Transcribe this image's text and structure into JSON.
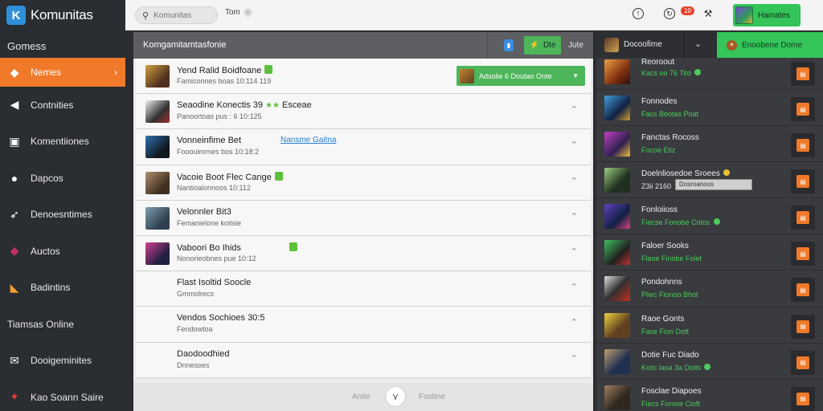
{
  "app": {
    "logo_text": "Komunitas",
    "section_label": "Gomess"
  },
  "sidebar": {
    "items": [
      {
        "label": "Nemes",
        "icon": "game-controller-icon",
        "active": true
      },
      {
        "label": "Contnities",
        "icon": "megaphone-icon"
      },
      {
        "label": "Komentiiones",
        "icon": "printer-icon"
      },
      {
        "label": "Dapcos",
        "icon": "globe-icon"
      },
      {
        "label": "Denoesntimes",
        "icon": "rocket-icon"
      },
      {
        "label": "Auctos",
        "icon": "gem-icon"
      },
      {
        "label": "Badintins",
        "icon": "box-icon"
      },
      {
        "label": "Tiamsas Online",
        "icon": ""
      },
      {
        "label": "Dooigeminites",
        "icon": "mail-icon"
      },
      {
        "label": "Kao Soann Saire",
        "icon": "puzzle-icon"
      }
    ]
  },
  "topbar": {
    "search_placeholder": "Komunitas",
    "filter_chip": "Tom",
    "notification_count": "10",
    "profile_label": "Hamates"
  },
  "center": {
    "header_title": "Komgamitamtasfonie",
    "header_button": "Dte",
    "header_sort": "Jute",
    "rows": [
      {
        "title": "Yend Ralid Boidfoane",
        "sub": "Famiconnes boas 10:114 119",
        "badge": true,
        "action_label": "Adsolie 6 Doutao Onte"
      },
      {
        "title": "Seaodine Konectis 39",
        "stars": "★★",
        "title_tail": "Esceae",
        "sub": "Panoortoas pus : 6 10:125"
      },
      {
        "title": "Vonneinfime Bet",
        "sub": "Fooouimrnes bos 10:18:2",
        "link": "Nansme Gaitna"
      },
      {
        "title": "Vacoie Boot Flec Cange",
        "sub": "Nantioalonnoos 10:112",
        "badge": true
      },
      {
        "title": "Velonnler Bit3",
        "sub": "Femanielone koitsie"
      },
      {
        "title": "Vaboori Bo Ihids",
        "sub": "Nonorieobnes pue 10:12",
        "badge": true
      },
      {
        "title": "Flast Isoltid Soocle",
        "sub": "Gmmolrecs"
      },
      {
        "title": "Vendos Sochioes 30:5",
        "sub": "Fendowtoa"
      },
      {
        "title": "Daodoodhied",
        "sub": "Dnnesoes"
      }
    ],
    "footer_left": "Anite",
    "footer_right": "Fostine"
  },
  "right": {
    "header_title": "Docoofime",
    "header_button": "Enoobene Dome",
    "items": [
      {
        "title": "Reoroout",
        "sub": "Kacs oo 76 Tito",
        "dot": "green"
      },
      {
        "title": "Fonnodes",
        "sub": "Facs Beotas Poat"
      },
      {
        "title": "Fanctas Rocoss",
        "sub": "Focoe Etiz"
      },
      {
        "title": "Doelnliosedoe Sroees",
        "sub": "Z3ii 2160",
        "dot": "gold",
        "progress": "Dosroanoos"
      },
      {
        "title": "Fonloiioss",
        "sub": "Fiecse Fonobe Cotos",
        "dot": "green"
      },
      {
        "title": "Faloer Sooks",
        "sub": "Fleoe Finobe Foiet"
      },
      {
        "title": "Pondohnns",
        "sub": "Pliec Fionoo Bhot"
      },
      {
        "title": "Raoe Gonts",
        "sub": "Fase Fion Dott"
      },
      {
        "title": "Dotie Fuc Diado",
        "sub": "Kiolc lasa 3a Doits",
        "dot": "green"
      },
      {
        "title": "Fosclae Diapoes",
        "sub": "Fiecs Fomoe Cioft"
      }
    ]
  },
  "colors": {
    "accent_orange": "#f07a2a",
    "accent_green": "#34c45a",
    "sidebar_bg": "#2a2d32"
  }
}
